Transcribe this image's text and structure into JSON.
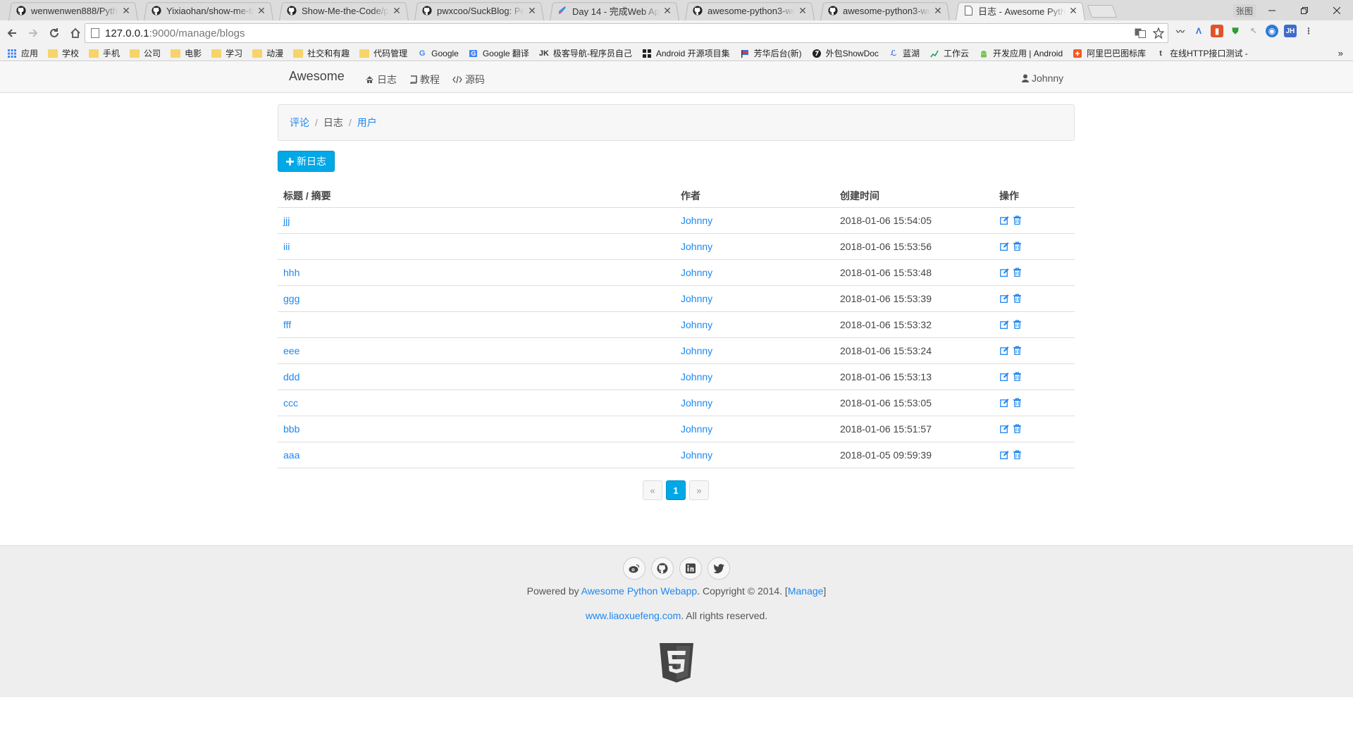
{
  "browser": {
    "tabs": [
      {
        "title": "wenwenwen888/Pytho",
        "icon": "github-icon",
        "active": false
      },
      {
        "title": "Yixiaohan/show-me-th",
        "icon": "github-icon",
        "active": false
      },
      {
        "title": "Show-Me-the-Code/p",
        "icon": "github-icon",
        "active": false
      },
      {
        "title": "pwxcoo/SuckBlog: Per",
        "icon": "github-icon",
        "active": false
      },
      {
        "title": "Day 14 - 完成Web App",
        "icon": "rocket-icon",
        "active": false
      },
      {
        "title": "awesome-python3-we",
        "icon": "github-icon",
        "active": false
      },
      {
        "title": "awesome-python3-we",
        "icon": "github-icon",
        "active": false
      },
      {
        "title": "日志 - Awesome Pytho",
        "icon": "page-icon",
        "active": true
      }
    ],
    "user_badge": "张图",
    "url_host": "127.0.0.1",
    "url_path": ":9000/manage/blogs",
    "extensions": [
      "JH"
    ],
    "bookmarks": [
      {
        "label": "应用",
        "icon": "apps-grid-icon"
      },
      {
        "label": "学校",
        "icon": "folder-icon"
      },
      {
        "label": "手机",
        "icon": "folder-icon"
      },
      {
        "label": "公司",
        "icon": "folder-icon"
      },
      {
        "label": "电影",
        "icon": "folder-icon"
      },
      {
        "label": "学习",
        "icon": "folder-icon"
      },
      {
        "label": "动漫",
        "icon": "folder-icon"
      },
      {
        "label": "社交和有趣",
        "icon": "folder-icon"
      },
      {
        "label": "代码管理",
        "icon": "folder-icon"
      },
      {
        "label": "Google",
        "icon": "google-icon"
      },
      {
        "label": "Google 翻译",
        "icon": "translate-icon"
      },
      {
        "label": "极客导航-程序员自己",
        "icon": "jk-icon"
      },
      {
        "label": "Android 开源项目集",
        "icon": "android-grid-icon"
      },
      {
        "label": "芳华后台(新)",
        "icon": "flag-icon"
      },
      {
        "label": "外包ShowDoc",
        "icon": "showdoc-icon"
      },
      {
        "label": "蓝湖",
        "icon": "lanhu-icon"
      },
      {
        "label": "工作云",
        "icon": "chart-icon"
      },
      {
        "label": "开发应用 | Android",
        "icon": "android-icon"
      },
      {
        "label": "阿里巴巴图标库",
        "icon": "iconfont-icon"
      },
      {
        "label": "在线HTTP接口测试 -",
        "icon": "tumblr-icon"
      }
    ],
    "more_symbol": "»"
  },
  "site": {
    "brand": "Awesome",
    "nav": [
      {
        "label": "日志",
        "icon": "home-icon"
      },
      {
        "label": "教程",
        "icon": "book-icon"
      },
      {
        "label": "源码",
        "icon": "code-icon"
      }
    ],
    "user": "Johnny"
  },
  "breadcrumb": {
    "items": [
      {
        "label": "评论",
        "link": true
      },
      {
        "label": "日志",
        "link": false
      },
      {
        "label": "用户",
        "link": true
      }
    ],
    "separator": "/"
  },
  "new_button": "新日志",
  "table": {
    "headers": [
      "标题 / 摘要",
      "作者",
      "创建时间",
      "操作"
    ],
    "rows": [
      {
        "title": "jjj",
        "author": "Johnny",
        "created": "2018-01-06 15:54:05"
      },
      {
        "title": "iii",
        "author": "Johnny",
        "created": "2018-01-06 15:53:56"
      },
      {
        "title": "hhh",
        "author": "Johnny",
        "created": "2018-01-06 15:53:48"
      },
      {
        "title": "ggg",
        "author": "Johnny",
        "created": "2018-01-06 15:53:39"
      },
      {
        "title": "fff",
        "author": "Johnny",
        "created": "2018-01-06 15:53:32"
      },
      {
        "title": "eee",
        "author": "Johnny",
        "created": "2018-01-06 15:53:24"
      },
      {
        "title": "ddd",
        "author": "Johnny",
        "created": "2018-01-06 15:53:13"
      },
      {
        "title": "ccc",
        "author": "Johnny",
        "created": "2018-01-06 15:53:05"
      },
      {
        "title": "bbb",
        "author": "Johnny",
        "created": "2018-01-06 15:51:57"
      },
      {
        "title": "aaa",
        "author": "Johnny",
        "created": "2018-01-05 09:59:39"
      }
    ]
  },
  "pagination": {
    "prev": "«",
    "pages": [
      "1"
    ],
    "current": "1",
    "next": "»"
  },
  "footer": {
    "social": [
      "weibo-icon",
      "github-icon",
      "linkedin-icon",
      "twitter-icon"
    ],
    "powered_prefix": "Powered by ",
    "powered_link": "Awesome Python Webapp",
    "copyright": ". Copyright © 2014. [",
    "manage_link": "Manage",
    "manage_suffix": "]",
    "site_link": "www.liaoxuefeng.com",
    "rights": ". All rights reserved."
  },
  "colors": {
    "link": "#1e87f0",
    "primary": "#00a8e6",
    "footer_bg": "#eeeeee"
  }
}
